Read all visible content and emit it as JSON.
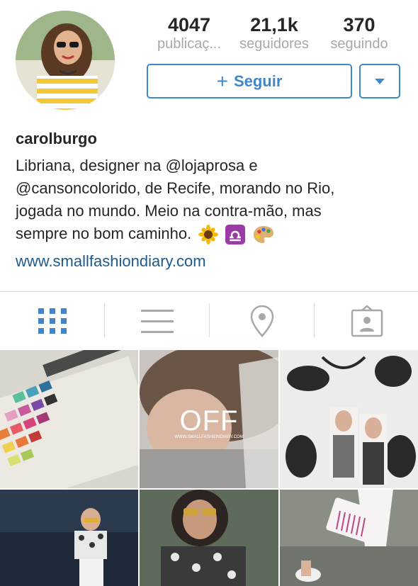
{
  "profile": {
    "username": "carolburgo",
    "bio_lines": [
      "Libriana, designer na @lojaprosa e",
      "@cansoncolorido, de Recife, morando no Rio,",
      "jogada no mundo. Meio na contra-mão, mas",
      "sempre no bom caminho."
    ],
    "website": "www.smallfashiondiary.com"
  },
  "stats": [
    {
      "value": "4047",
      "label": "publicaç..."
    },
    {
      "value": "21,1k",
      "label": "seguidores"
    },
    {
      "value": "370",
      "label": "seguindo"
    }
  ],
  "actions": {
    "follow_label": "Seguir"
  },
  "tabs": [
    "grid",
    "list",
    "location",
    "tagged"
  ],
  "posts": [
    {
      "overlay": ""
    },
    {
      "overlay": "OFF",
      "caption": "WWW.SMALLFASHIONDIARY.COM"
    },
    {
      "overlay": ""
    },
    {
      "overlay": ""
    },
    {
      "overlay": ""
    },
    {
      "overlay": ""
    }
  ],
  "colors": {
    "accent": "#3f87c9",
    "link": "#1e5a8c",
    "muted": "#a8a8a8"
  }
}
